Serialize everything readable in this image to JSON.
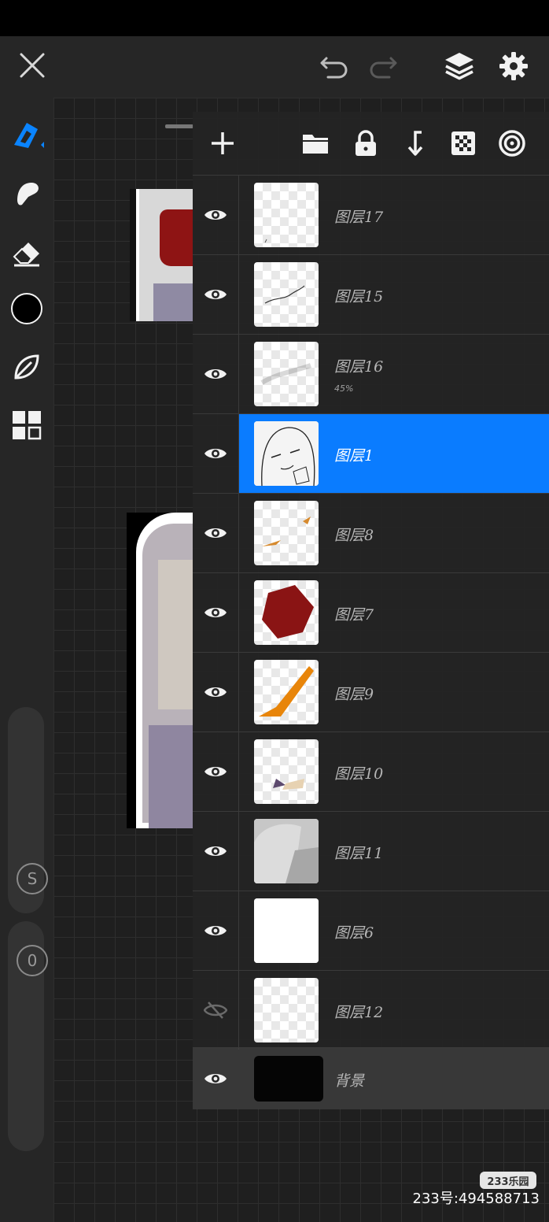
{
  "toolbar": {
    "close_icon": "close-icon",
    "undo_icon": "undo-icon",
    "redo_icon": "redo-icon",
    "layers_icon": "layers-icon",
    "settings_icon": "gear-icon"
  },
  "tools": [
    "brush-icon",
    "smudge-icon",
    "eraser-icon",
    "color-icon",
    "shape-icon",
    "gallery-icon"
  ],
  "sliders": {
    "size_label": "S",
    "opacity_label": "0"
  },
  "layers_panel": {
    "actions": [
      "add-layer-icon",
      "folder-icon",
      "lock-icon",
      "merge-down-icon",
      "alpha-lock-icon",
      "blend-icon"
    ],
    "layers": [
      {
        "name": "图层17",
        "opacity": "",
        "visible": true,
        "selected": false
      },
      {
        "name": "图层15",
        "opacity": "",
        "visible": true,
        "selected": false
      },
      {
        "name": "图层16",
        "opacity": "45%",
        "visible": true,
        "selected": false
      },
      {
        "name": "图层1",
        "opacity": "",
        "visible": true,
        "selected": true
      },
      {
        "name": "图层8",
        "opacity": "",
        "visible": true,
        "selected": false
      },
      {
        "name": "图层7",
        "opacity": "",
        "visible": true,
        "selected": false
      },
      {
        "name": "图层9",
        "opacity": "",
        "visible": true,
        "selected": false
      },
      {
        "name": "图层10",
        "opacity": "",
        "visible": true,
        "selected": false
      },
      {
        "name": "图层11",
        "opacity": "",
        "visible": true,
        "selected": false
      },
      {
        "name": "图层6",
        "opacity": "",
        "visible": true,
        "selected": false
      },
      {
        "name": "图层12",
        "opacity": "",
        "visible": false,
        "selected": false
      }
    ],
    "background_layer": {
      "name": "背景",
      "visible": true
    }
  },
  "watermark": {
    "logo": "233乐园",
    "text": "233号:494588713"
  },
  "colors": {
    "accent": "#0a7cff",
    "current_color": "#000000"
  }
}
